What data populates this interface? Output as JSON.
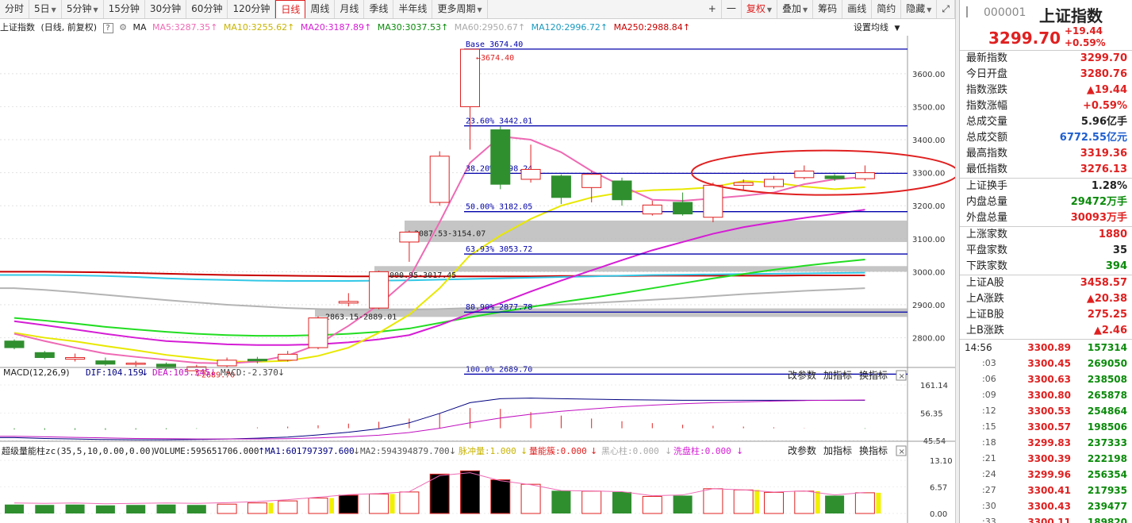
{
  "toolbar": {
    "left": [
      "分时",
      "5日",
      "5分钟",
      "15分钟",
      "30分钟",
      "60分钟",
      "120分钟",
      "日线",
      "周线",
      "月线",
      "季线",
      "半年线",
      "更多周期"
    ],
    "active_index": 7,
    "right": [
      "+",
      "一",
      "复权",
      "叠加",
      "筹码",
      "画线",
      "简约",
      "隐藏"
    ],
    "restore_icon": "restore-window-icon"
  },
  "info": {
    "name": "上证指数",
    "mode": "(日线, 前复权)",
    "ma_label": "MA",
    "ma5": "MA5:3287.35",
    "ma10": "MA10:3255.62",
    "ma20": "MA20:3187.89",
    "ma30": "MA30:3037.53",
    "ma60": "MA60:2950.67",
    "ma120": "MA120:2996.72",
    "ma250": "MA250:2988.84",
    "settings": "设置均线"
  },
  "colors": {
    "up": "#e02020",
    "down": "#2f8f2f",
    "ma5": "#ee6ab4",
    "ma10": "#e8e800",
    "ma20": "#d51dd5",
    "ma30": "#22dd22",
    "ma60": "#b4b4b4",
    "ma120": "#32c8e6",
    "ma250": "#c80000",
    "fib": "#0000aa"
  },
  "price_axis": [
    "3600.00",
    "3500.00",
    "3400.00",
    "3300.00",
    "3200.00",
    "3100.00",
    "3000.00",
    "2900.00",
    "2800.00"
  ],
  "price_range": [
    2710,
    3715
  ],
  "fib_labels": [
    {
      "text": "Base   3674.40",
      "value": 3674.4
    },
    {
      "text": "23.60% 3442.01",
      "value": 3442.01
    },
    {
      "text": "38.20% 3298.24",
      "value": 3298.24
    },
    {
      "text": "50.00% 3182.05",
      "value": 3182.05
    },
    {
      "text": "63.93% 3053.72",
      "value": 3053.72
    },
    {
      "text": "80.90% 2877.78",
      "value": 2877.78
    },
    {
      "text": "100.0% 2689.70",
      "value": 2689.7
    }
  ],
  "gap_labels": [
    {
      "text": "3087.53-3154.07",
      "value": 3108
    },
    {
      "text": "3000.95-3017.45",
      "value": 2982
    },
    {
      "text": "2863.15-2889.01",
      "value": 2856
    }
  ],
  "gap_zones": [
    [
      3090,
      3155
    ],
    [
      3000,
      3017
    ],
    [
      2863,
      2889
    ]
  ],
  "peak_label": "3674.40",
  "low_label": "2689.70",
  "chart_data": {
    "type": "candlestick",
    "candles": [
      {
        "o": 2790,
        "c": 2770,
        "h": 2795,
        "l": 2765
      },
      {
        "o": 2755,
        "c": 2740,
        "h": 2760,
        "l": 2735
      },
      {
        "o": 2735,
        "c": 2740,
        "h": 2752,
        "l": 2728
      },
      {
        "o": 2730,
        "c": 2720,
        "h": 2740,
        "l": 2715
      },
      {
        "o": 2720,
        "c": 2723,
        "h": 2730,
        "l": 2712
      },
      {
        "o": 2720,
        "c": 2708,
        "h": 2725,
        "l": 2704
      },
      {
        "o": 2700,
        "c": 2712,
        "h": 2718,
        "l": 2690
      },
      {
        "o": 2715,
        "c": 2732,
        "h": 2740,
        "l": 2710
      },
      {
        "o": 2735,
        "c": 2730,
        "h": 2742,
        "l": 2722
      },
      {
        "o": 2732,
        "c": 2750,
        "h": 2760,
        "l": 2728
      },
      {
        "o": 2770,
        "c": 2860,
        "h": 2865,
        "l": 2765
      },
      {
        "o": 2905,
        "c": 2910,
        "h": 2935,
        "l": 2895
      },
      {
        "o": 2890,
        "c": 3000,
        "h": 3003,
        "l": 2886
      },
      {
        "o": 3090,
        "c": 3120,
        "h": 3125,
        "l": 3030
      },
      {
        "o": 3210,
        "c": 3350,
        "h": 3365,
        "l": 3200
      },
      {
        "o": 3500,
        "c": 3674,
        "h": 3674,
        "l": 3370
      },
      {
        "o": 3430,
        "c": 3265,
        "h": 3440,
        "l": 3250
      },
      {
        "o": 3280,
        "c": 3310,
        "h": 3385,
        "l": 3270
      },
      {
        "o": 3290,
        "c": 3225,
        "h": 3295,
        "l": 3205
      },
      {
        "o": 3255,
        "c": 3295,
        "h": 3305,
        "l": 3210
      },
      {
        "o": 3275,
        "c": 3218,
        "h": 3285,
        "l": 3200
      },
      {
        "o": 3175,
        "c": 3202,
        "h": 3215,
        "l": 3170
      },
      {
        "o": 3210,
        "c": 3175,
        "h": 3240,
        "l": 3170
      },
      {
        "o": 3165,
        "c": 3262,
        "h": 3270,
        "l": 3150
      },
      {
        "o": 3262,
        "c": 3270,
        "h": 3280,
        "l": 3245
      },
      {
        "o": 3258,
        "c": 3280,
        "h": 3290,
        "l": 3252
      },
      {
        "o": 3285,
        "c": 3305,
        "h": 3322,
        "l": 3280
      },
      {
        "o": 3290,
        "c": 3282,
        "h": 3296,
        "l": 3275
      },
      {
        "o": 3282,
        "c": 3300,
        "h": 3322,
        "l": 3276
      }
    ],
    "ma_lines": {
      "ma5": [
        2812,
        2790,
        2770,
        2752,
        2742,
        2733,
        2724,
        2722,
        2728,
        2746,
        2780,
        2836,
        2900,
        2980,
        3150,
        3330,
        3410,
        3400,
        3362,
        3305,
        3260,
        3218,
        3215,
        3222,
        3230,
        3240,
        3265,
        3280,
        3287
      ],
      "ma10": [
        2815,
        2800,
        2789,
        2775,
        2762,
        2748,
        2738,
        2728,
        2727,
        2730,
        2745,
        2770,
        2815,
        2870,
        2950,
        3050,
        3110,
        3160,
        3200,
        3225,
        3240,
        3247,
        3250,
        3256,
        3275,
        3270,
        3258,
        3250,
        3256
      ],
      "ma20": [
        2850,
        2838,
        2825,
        2812,
        2800,
        2790,
        2785,
        2780,
        2778,
        2778,
        2780,
        2786,
        2795,
        2808,
        2838,
        2873,
        2905,
        2940,
        2973,
        3004,
        3035,
        3065,
        3090,
        3115,
        3135,
        3150,
        3163,
        3175,
        3188
      ],
      "ma30": [
        2860,
        2852,
        2843,
        2833,
        2825,
        2818,
        2812,
        2808,
        2806,
        2806,
        2808,
        2812,
        2818,
        2828,
        2845,
        2862,
        2878,
        2893,
        2908,
        2921,
        2935,
        2950,
        2965,
        2980,
        2993,
        3006,
        3018,
        3028,
        3037
      ],
      "ma60": [
        2950,
        2945,
        2938,
        2930,
        2922,
        2914,
        2907,
        2900,
        2895,
        2890,
        2887,
        2885,
        2885,
        2885,
        2887,
        2890,
        2893,
        2896,
        2900,
        2905,
        2910,
        2915,
        2920,
        2926,
        2932,
        2937,
        2942,
        2946,
        2950
      ],
      "ma120": [
        2990,
        2990,
        2989,
        2987,
        2984,
        2980,
        2977,
        2975,
        2973,
        2972,
        2972,
        2972,
        2973,
        2974,
        2976,
        2978,
        2980,
        2982,
        2984,
        2986,
        2988,
        2990,
        2991,
        2992,
        2993,
        2994,
        2995,
        2996,
        2997
      ],
      "ma250": [
        3000,
        3000,
        2999,
        2998,
        2996,
        2994,
        2992,
        2990,
        2989,
        2988,
        2987,
        2986,
        2986,
        2986,
        2986,
        2986,
        2986,
        2986,
        2987,
        2987,
        2987,
        2988,
        2988,
        2988,
        2988,
        2988,
        2989,
        2989,
        2989
      ]
    },
    "macd": {
      "title": "MACD(12,26,9)",
      "dif": "DIF:104.159",
      "dea": "DEA:105.345",
      "macd": "MACD:-2.370",
      "axis": [
        "161.14",
        "56.35",
        "-45.54"
      ],
      "range": [
        -45.54,
        161.14
      ],
      "dif_values": [
        -35,
        -38,
        -40,
        -42,
        -43,
        -43,
        -42,
        -40,
        -37,
        -33,
        -25,
        -15,
        -2,
        20,
        55,
        95,
        110,
        112,
        110,
        108,
        106,
        105,
        104,
        104,
        104,
        104,
        104,
        104,
        104
      ],
      "dea_values": [
        -30,
        -32,
        -34,
        -36,
        -38,
        -39,
        -40,
        -40,
        -40,
        -39,
        -36,
        -32,
        -26,
        -16,
        0,
        20,
        38,
        52,
        63,
        72,
        80,
        86,
        91,
        95,
        98,
        101,
        103,
        104,
        105
      ],
      "hist": [
        -5,
        -6,
        -6,
        -6,
        -5,
        -4,
        -2,
        0,
        3,
        6,
        11,
        17,
        24,
        36,
        55,
        75,
        72,
        60,
        47,
        36,
        26,
        19,
        13,
        9,
        6,
        3,
        1,
        0,
        -2
      ]
    },
    "vol": {
      "title": "超级量能柱zc(35,5,10,0.00,0.00)",
      "volume": "VOLUME:595651706.000",
      "ma1": "MA1:601797397.600",
      "ma2": "MA2:594394879.700",
      "pulse": "脉冲量:1.000",
      "qns": "量能簇:0.000",
      "hxz": "黑心柱:0.000",
      "xpz": "洗盘柱:0.000",
      "axis": [
        "13.10",
        "6.57",
        "0.00"
      ],
      "range": [
        0,
        13.1
      ],
      "bars": [
        2.2,
        2.1,
        2.2,
        2.0,
        2.1,
        2.2,
        2.1,
        2.3,
        2.6,
        3.1,
        3.8,
        4.5,
        4.8,
        5.3,
        9.7,
        10.5,
        8.3,
        7.2,
        5.6,
        5.5,
        5.3,
        4.2,
        4.4,
        6.1,
        5.8,
        5.2,
        5.5,
        4.4,
        5.1
      ],
      "kinds": [
        "g",
        "g",
        "g",
        "g",
        "g",
        "g",
        "g",
        "r",
        "r",
        "r",
        "r",
        "k",
        "r",
        "r",
        "k",
        "k",
        "k",
        "r",
        "g",
        "r",
        "g",
        "r",
        "g",
        "r",
        "r",
        "r",
        "r",
        "g",
        "r"
      ]
    }
  },
  "panel_buttons": [
    "改参数",
    "加指标",
    "换指标"
  ],
  "right_panel": {
    "code": "000001",
    "name": "上证指数",
    "price": "3299.70",
    "change": "+19.44",
    "percent": "+0.59%",
    "group1": [
      {
        "label": "最新指数",
        "value": "3299.70",
        "color": "red"
      },
      {
        "label": "今日开盘",
        "value": "3280.76",
        "color": "red"
      },
      {
        "label": "指数涨跌",
        "value": "▲19.44",
        "color": "red"
      },
      {
        "label": "指数涨幅",
        "value": "+0.59%",
        "color": "red"
      },
      {
        "label": "总成交量",
        "value": "5.96亿手",
        "color": "blk"
      },
      {
        "label": "总成交额",
        "value": "6772.55亿元",
        "color": "blue"
      },
      {
        "label": "最高指数",
        "value": "3319.36",
        "color": "red"
      },
      {
        "label": "最低指数",
        "value": "3276.13",
        "color": "red"
      }
    ],
    "group2": [
      {
        "label": "上证换手",
        "value": "1.28%",
        "color": "blk"
      },
      {
        "label": "内盘总量",
        "value": "29472万手",
        "color": "green"
      },
      {
        "label": "外盘总量",
        "value": "30093万手",
        "color": "red"
      }
    ],
    "group3": [
      {
        "label": "上涨家数",
        "value": "1880",
        "color": "red"
      },
      {
        "label": "平盘家数",
        "value": "35",
        "color": "blk"
      },
      {
        "label": "下跌家数",
        "value": "394",
        "color": "green"
      }
    ],
    "group4": [
      {
        "label": "上证A股",
        "value": "3458.57",
        "color": "red"
      },
      {
        "label": "上A涨跌",
        "value": "▲20.38",
        "color": "red"
      },
      {
        "label": "上证B股",
        "value": "275.25",
        "color": "red"
      },
      {
        "label": "上B涨跌",
        "value": "▲2.46",
        "color": "red"
      }
    ],
    "ticks": [
      {
        "t": "14:56",
        "p": "3300.89",
        "v": "157314"
      },
      {
        "t": ":03",
        "p": "3300.45",
        "v": "269050"
      },
      {
        "t": ":06",
        "p": "3300.63",
        "v": "238508"
      },
      {
        "t": ":09",
        "p": "3300.80",
        "v": "265878"
      },
      {
        "t": ":12",
        "p": "3300.53",
        "v": "254864"
      },
      {
        "t": ":15",
        "p": "3300.57",
        "v": "198506"
      },
      {
        "t": ":18",
        "p": "3299.83",
        "v": "237333"
      },
      {
        "t": ":21",
        "p": "3300.39",
        "v": "222198"
      },
      {
        "t": ":24",
        "p": "3299.96",
        "v": "256354"
      },
      {
        "t": ":27",
        "p": "3300.41",
        "v": "217935"
      },
      {
        "t": ":30",
        "p": "3300.43",
        "v": "239477"
      },
      {
        "t": ":33",
        "p": "3300.11",
        "v": "189820"
      }
    ]
  }
}
